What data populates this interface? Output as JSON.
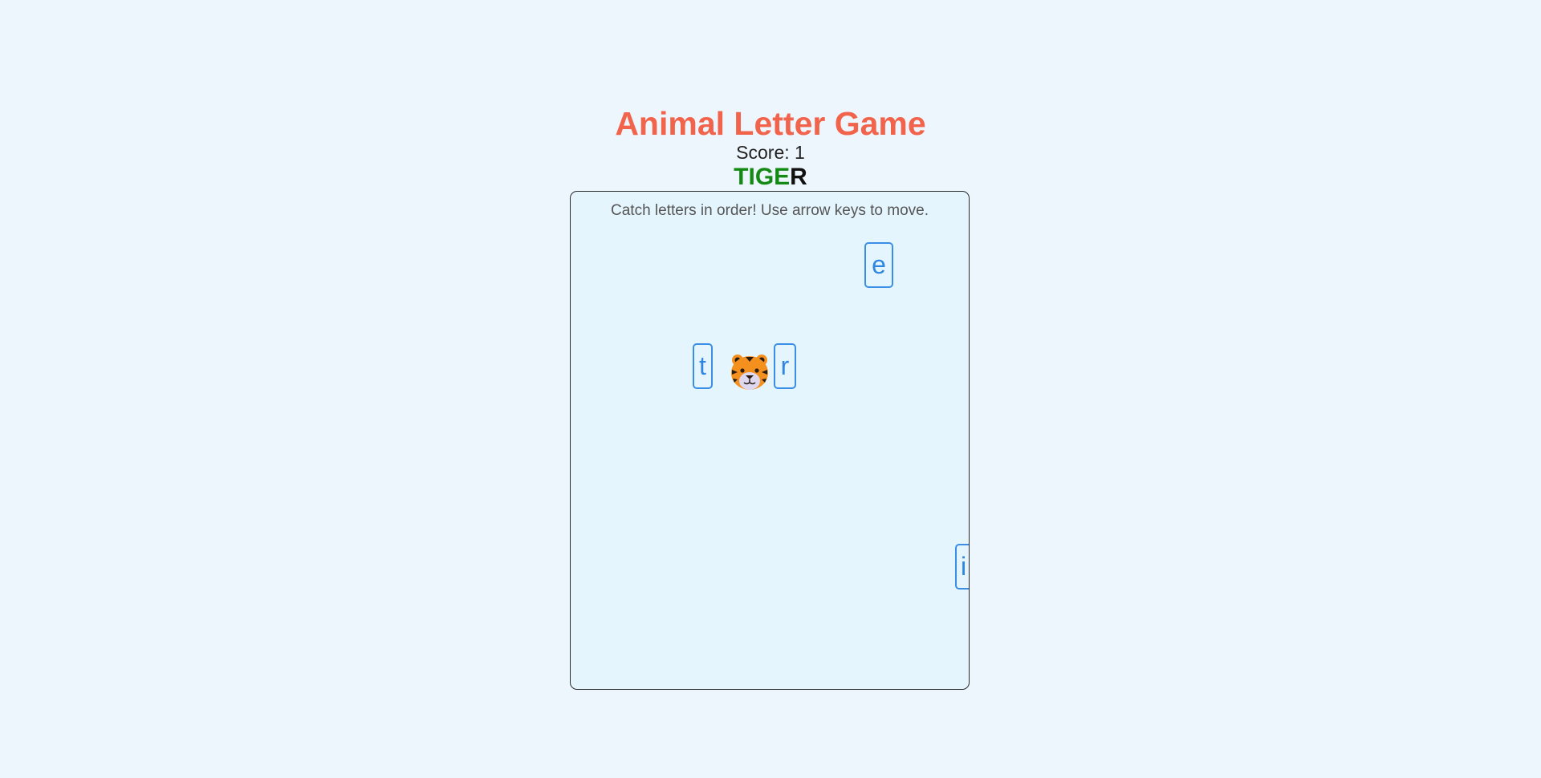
{
  "game": {
    "title": "Animal Letter Game",
    "score": "Score: 1",
    "target_word": {
      "caught": "TIGE",
      "remaining": "R"
    },
    "instructions": "Catch letters in order! Use arrow keys to move.",
    "player": "tiger-emoji",
    "falling_letters": [
      {
        "char": "e"
      },
      {
        "char": "t"
      },
      {
        "char": "r"
      },
      {
        "char": "i"
      }
    ]
  },
  "colors": {
    "title": "#f2634b",
    "caught": "#148a14",
    "remaining": "#111111",
    "letter_border": "#3a8ee6",
    "board_bg": "#e5f5fd",
    "page_bg": "#eef6fd"
  }
}
